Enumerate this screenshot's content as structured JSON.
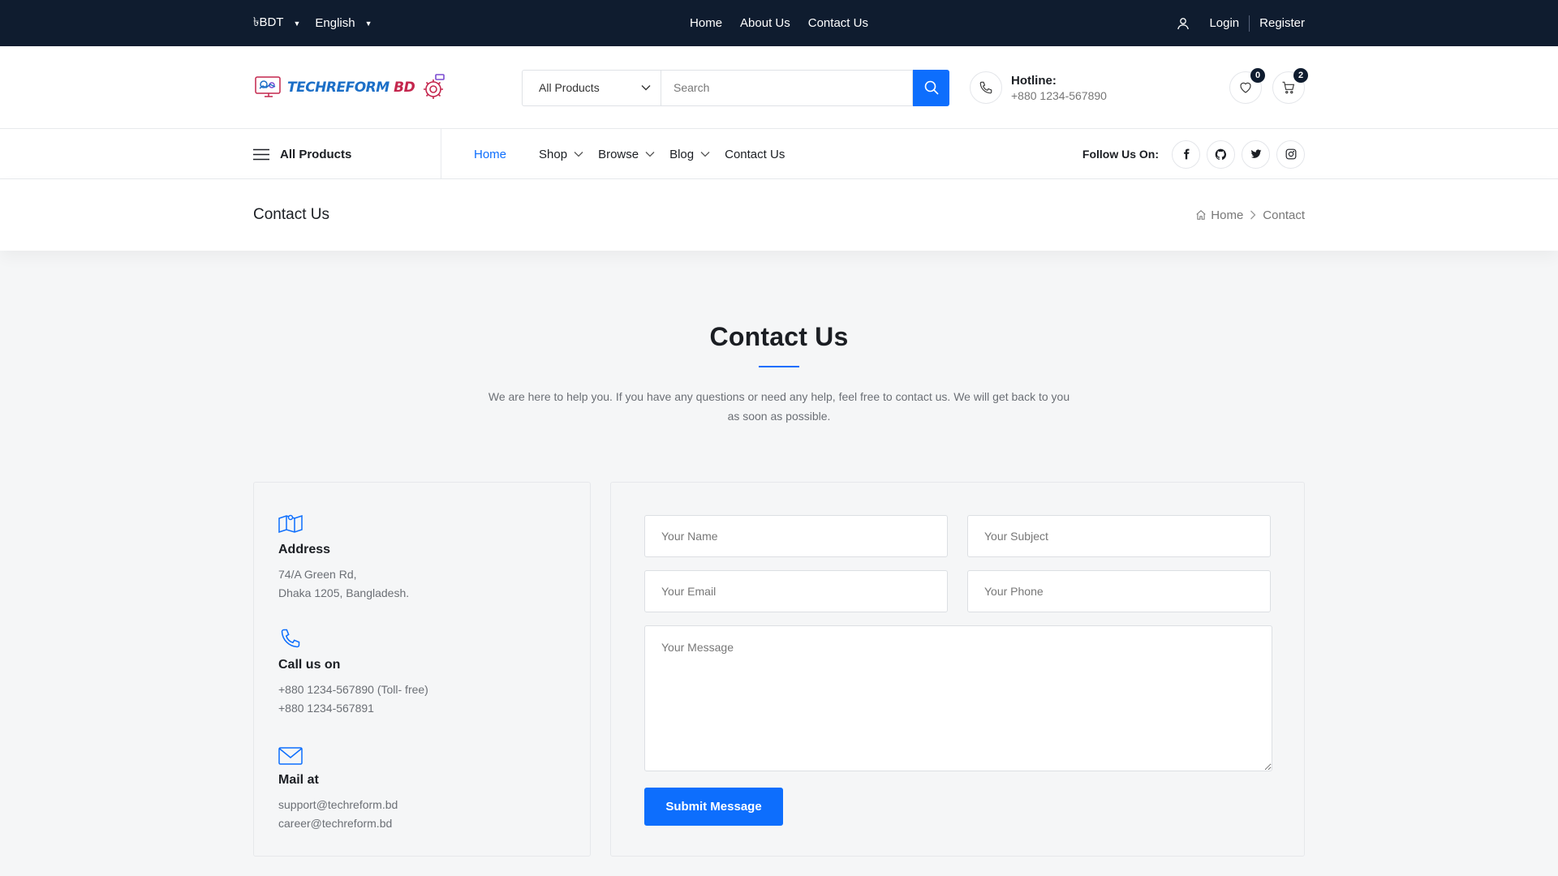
{
  "topbar": {
    "currency": "৳BDT",
    "language": "English",
    "links": [
      "Home",
      "About Us",
      "Contact Us"
    ],
    "login": "Login",
    "register": "Register"
  },
  "header": {
    "logo_text": "TECHREFORM",
    "logo_suffix": "BD",
    "category": "All Products",
    "search_placeholder": "Search",
    "hotline_label": "Hotline:",
    "hotline_number": "+880 1234-567890",
    "wishlist_count": "0",
    "cart_count": "2"
  },
  "nav": {
    "all_products": "All Products",
    "items": [
      "Home",
      "Shop",
      "Browse",
      "Blog",
      "Contact Us"
    ],
    "follow_label": "Follow Us On:"
  },
  "breadcrumb": {
    "title": "Contact Us",
    "home": "Home",
    "current": "Contact"
  },
  "intro": {
    "heading": "Contact Us",
    "text": "We are here to help you. If you have any questions or need any help, feel free to contact us. We will get back to you as soon as possible."
  },
  "info": {
    "address_title": "Address",
    "address_lines": [
      "74/A Green Rd,",
      "Dhaka 1205, Bangladesh."
    ],
    "call_title": "Call us on",
    "call_lines": [
      "+880 1234-567890 (Toll- free)",
      "+880 1234-567891"
    ],
    "mail_title": "Mail at",
    "mail_lines": [
      "support@techreform.bd",
      "career@techreform.bd"
    ]
  },
  "form": {
    "name_placeholder": "Your Name",
    "subject_placeholder": "Your Subject",
    "email_placeholder": "Your Email",
    "phone_placeholder": "Your Phone",
    "message_placeholder": "Your Message",
    "submit_label": "Submit Message"
  },
  "colors": {
    "topbar_bg": "#0f1c2f",
    "accent": "#0d6efd"
  }
}
